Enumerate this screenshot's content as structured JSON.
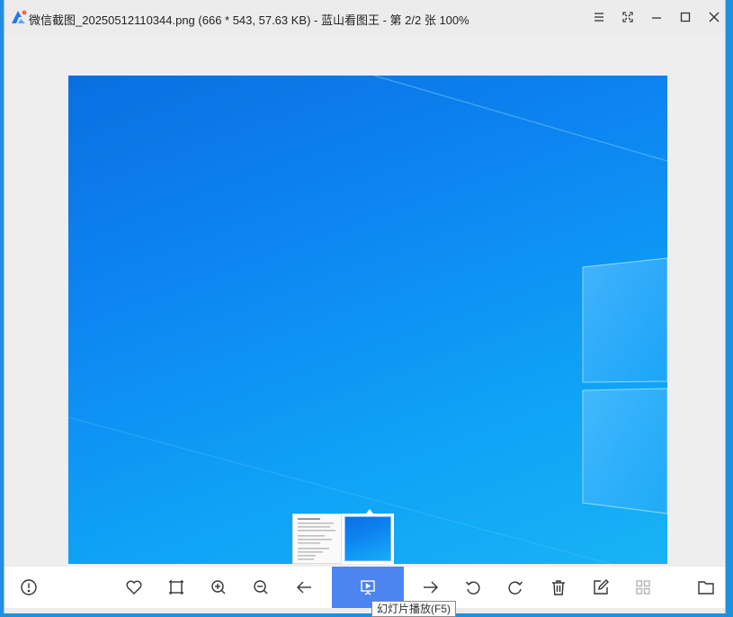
{
  "window": {
    "title": "微信截图_20250512110344.png (666 * 543, 57.63 KB) - 蓝山看图王 - 第 2/2 张 100%"
  },
  "title_controls": [
    {
      "name": "menu-icon"
    },
    {
      "name": "fullscreen-icon"
    },
    {
      "name": "minimize-icon"
    },
    {
      "name": "maximize-icon"
    },
    {
      "name": "close-icon"
    }
  ],
  "toolbar": {
    "buttons": [
      {
        "name": "info-button",
        "icon": "info-icon"
      },
      {
        "name": "favorite-button",
        "icon": "heart-icon"
      },
      {
        "name": "crop-button",
        "icon": "crop-icon"
      },
      {
        "name": "zoom-in-button",
        "icon": "zoom-in-icon"
      },
      {
        "name": "zoom-out-button",
        "icon": "zoom-out-icon"
      },
      {
        "name": "previous-button",
        "icon": "arrow-left-icon"
      },
      {
        "name": "slideshow-button",
        "icon": "slideshow-icon",
        "active": true
      },
      {
        "name": "next-button",
        "icon": "arrow-right-icon"
      },
      {
        "name": "rotate-left-button",
        "icon": "rotate-left-icon"
      },
      {
        "name": "rotate-right-button",
        "icon": "rotate-right-icon"
      },
      {
        "name": "delete-button",
        "icon": "trash-icon"
      },
      {
        "name": "edit-button",
        "icon": "edit-icon"
      },
      {
        "name": "grid-view-button",
        "icon": "grid-icon",
        "disabled": true
      },
      {
        "name": "open-folder-button",
        "icon": "folder-icon"
      }
    ],
    "tooltip": "幻灯片播放(F5)"
  },
  "colors": {
    "accent": "#4c84f0",
    "chrome": "#ececed"
  }
}
